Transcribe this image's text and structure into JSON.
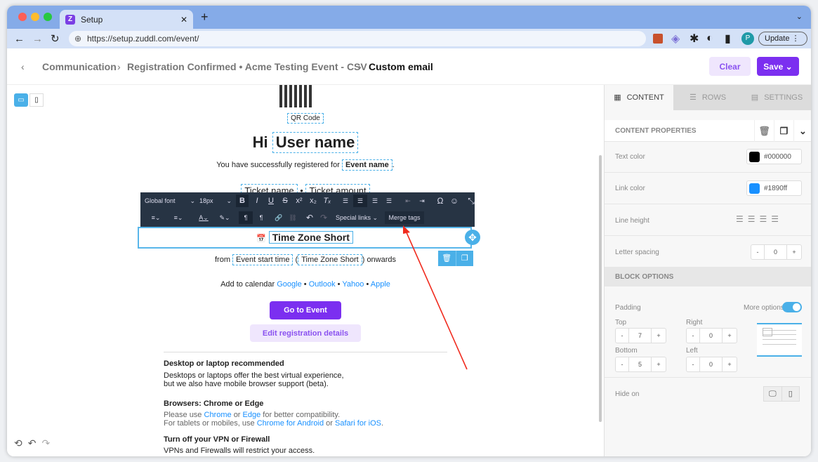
{
  "browser": {
    "tab_title": "Setup",
    "favicon": "Z",
    "url": "https://setup.zuddl.com/event/",
    "update_label": "Update",
    "profile_initial": "P"
  },
  "header": {
    "breadcrumbs": [
      "Communication",
      "Registration Confirmed • Acme Testing Event - CSV",
      "Custom email"
    ],
    "clear_label": "Clear",
    "save_label": "Save"
  },
  "email": {
    "qr_label": "QR Code",
    "greeting": "Hi",
    "user_name": "User name",
    "registered_text": "You have successfully registered for",
    "event_name": "Event name",
    "ticket_name": "Ticket name",
    "ticket_sep": "•",
    "ticket_amount": "Ticket amount",
    "selected_tag": "Time Zone Short",
    "from": "from",
    "event_start": "Event start time",
    "open_paren": "(",
    "tz_short": "Time Zone Short",
    "onwards": ") onwards",
    "add_to_calendar": "Add to calendar",
    "cal_links": [
      "Google",
      "Outlook",
      "Yahoo",
      "Apple"
    ],
    "bullet": "•",
    "go_to_event": "Go to Event",
    "edit_registration": "Edit registration details",
    "sections": [
      {
        "title": "Desktop or laptop recommended",
        "line1": "Desktops or laptops offer the best virtual experience,",
        "line2": "but we also have mobile browser support (beta)."
      },
      {
        "title": "Browsers: Chrome or Edge",
        "p1a": "Please use",
        "chrome": "Chrome",
        "or": "or",
        "edge": "Edge",
        "p1b": "for better compatibility.",
        "p2a": "For tablets or mobiles, use",
        "chrome_android": "Chrome for Android",
        "safari_ios": "Safari for iOS",
        "period": "."
      },
      {
        "title": "Turn off your VPN or Firewall",
        "line1": "VPNs and Firewalls will restrict your access."
      }
    ]
  },
  "toolbar": {
    "font": "Global font",
    "size": "18px",
    "special_links": "Special links",
    "merge_tags": "Merge tags"
  },
  "panel": {
    "tabs": [
      "CONTENT",
      "ROWS",
      "SETTINGS"
    ],
    "content_properties": "CONTENT PROPERTIES",
    "text_color_label": "Text color",
    "text_color": "#000000",
    "link_color_label": "Link color",
    "link_color": "#1890ff",
    "line_height_label": "Line height",
    "letter_spacing_label": "Letter spacing",
    "letter_spacing": "0",
    "block_options": "BLOCK OPTIONS",
    "padding_label": "Padding",
    "more_options": "More options",
    "more_options_on": true,
    "top_label": "Top",
    "top": "7",
    "right_label": "Right",
    "right": "0",
    "bottom_label": "Bottom",
    "bottom": "5",
    "left_label": "Left",
    "left": "0",
    "minus": "-",
    "plus": "+",
    "hide_on_label": "Hide on"
  }
}
